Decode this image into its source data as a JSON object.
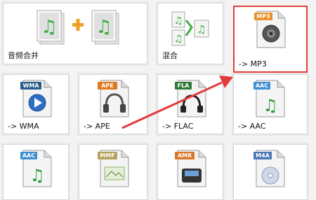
{
  "tiles": {
    "merge": {
      "label": "音频合并",
      "icon": "audio-merge-icon"
    },
    "mix": {
      "label": "混合",
      "icon": "audio-mix-icon"
    },
    "mp3": {
      "label": "-> MP3",
      "badge": "MP3",
      "icon": "speaker-icon",
      "badge_color": "#e8902a"
    },
    "wma": {
      "label": "-> WMA",
      "badge": "WMA",
      "icon": "play-disc-icon",
      "badge_color": "#2a5c8c"
    },
    "ape": {
      "label": "-> APE",
      "badge": "APE",
      "icon": "headphones-icon",
      "badge_color": "#e07a1e"
    },
    "flac": {
      "label": "-> FLAC",
      "badge": "FLA",
      "icon": "headset-icon",
      "badge_color": "#2f7a3a"
    },
    "aac": {
      "label": "-> AAC",
      "badge": "AAC",
      "icon": "music-note-icon",
      "badge_color": "#3d8fd1"
    },
    "row3_aac": {
      "label": "",
      "badge": "AAC",
      "icon": "music-note-icon",
      "badge_color": "#3d8fd1"
    },
    "row3_mmf": {
      "label": "",
      "badge": "MMF",
      "icon": "document-icon",
      "badge_color": "#b5a15a"
    },
    "row3_amr": {
      "label": "",
      "badge": "AMR",
      "icon": "device-icon",
      "badge_color": "#d9782a"
    },
    "row3_m4a": {
      "label": "",
      "badge": "M4A",
      "icon": "disc-icon",
      "badge_color": "#4b78b8"
    }
  },
  "colors": {
    "highlight": "#e23c3c",
    "arrow": "#e23c3c",
    "note_green": "#3fae3f",
    "plus_orange": "#f0a020"
  }
}
